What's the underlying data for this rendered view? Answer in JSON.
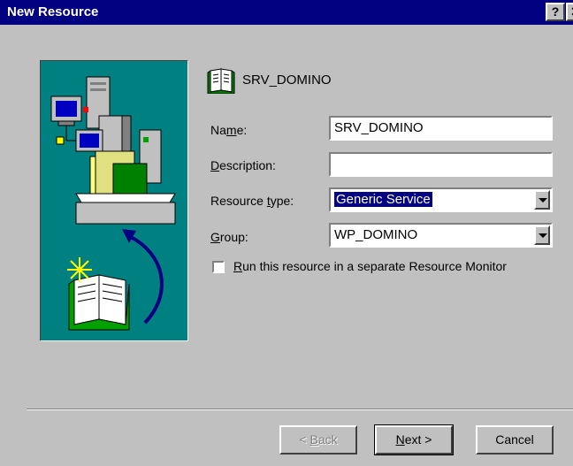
{
  "window": {
    "title": "New Resource",
    "help_label": "?",
    "close_label": "✕"
  },
  "header": {
    "resource_title": "SRV_DOMINO"
  },
  "form": {
    "name": {
      "label_pre": "Na",
      "label_key": "m",
      "label_post": "e:",
      "value": "SRV_DOMINO"
    },
    "description": {
      "label_pre": "",
      "label_key": "D",
      "label_post": "escription:",
      "value": ""
    },
    "resource_type": {
      "label_pre": "Resource ",
      "label_key": "t",
      "label_post": "ype:",
      "value": "Generic Service"
    },
    "group": {
      "label_pre": "",
      "label_key": "G",
      "label_post": "roup:",
      "value": "WP_DOMINO"
    },
    "separate_monitor": {
      "label_key": "R",
      "label_post": "un this resource in a separate Resource Monitor",
      "checked": false
    }
  },
  "buttons": {
    "back": {
      "label_pre": "< ",
      "label_key": "B",
      "label_post": "ack",
      "enabled": false
    },
    "next": {
      "label_key": "N",
      "label_post": "ext >"
    },
    "cancel": "Cancel"
  },
  "colors": {
    "title_bar": "#000080",
    "dialog_bg": "#c0c0c0",
    "illustration_bg": "#008080"
  },
  "icons": {
    "header": "resource-book-icon",
    "illustration": "servers-and-book-wizard-illustration"
  }
}
